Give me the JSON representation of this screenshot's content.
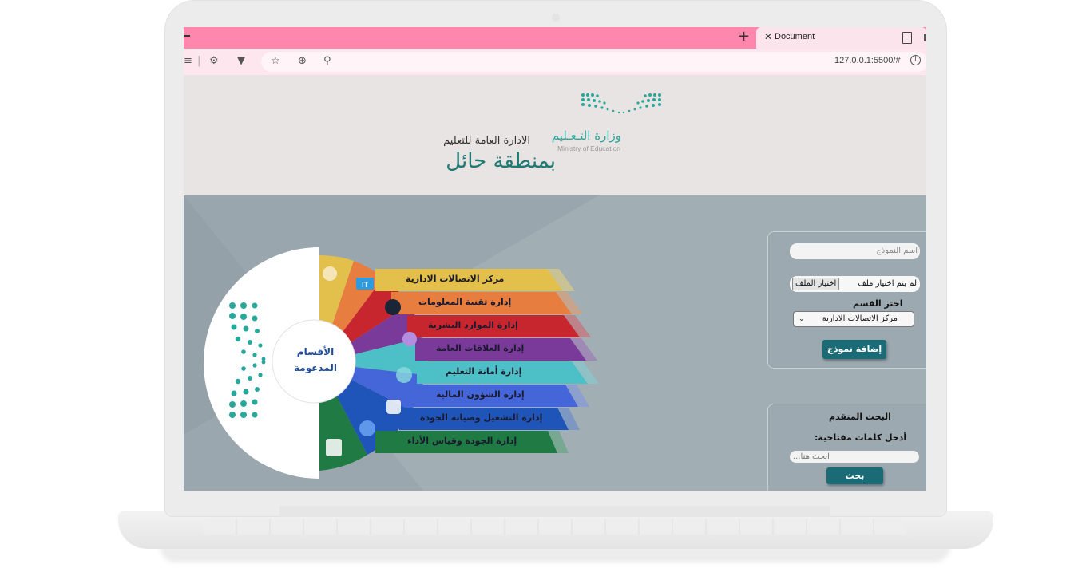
{
  "browser": {
    "tab_title": "Document",
    "url": "127.0.0.1:5500/#",
    "accent_color": "#ff87ad"
  },
  "header": {
    "ministry_arabic": "وزارة التـعـليم",
    "ministry_english": "Ministry of Education",
    "directorate_line1": "الادارة العامة للتعليم",
    "directorate_line2": "بمنطقة حائل"
  },
  "departments_wheel": {
    "center_line1": "الأقسام",
    "center_line2": "المدعومة",
    "items": [
      {
        "label": "مركز الاتصالات الادارية",
        "color": "#e3c04c"
      },
      {
        "label": "إدارة تقنية المعلومات",
        "color": "#e77d3f"
      },
      {
        "label": "إدارة الموارد البشرية",
        "color": "#c8262e"
      },
      {
        "label": "إدارة العلاقات العامة",
        "color": "#7a3a99"
      },
      {
        "label": "إدارة أمانة التعليم",
        "color": "#4cc0c6"
      },
      {
        "label": "إدارة الشؤون المالية",
        "color": "#4566d8"
      },
      {
        "label": "إدارة التشغيل وصيانة الجودة",
        "color": "#1f55b8"
      },
      {
        "label": "إدارة الجودة وقياس الأداء",
        "color": "#1f7a43"
      }
    ]
  },
  "add_form": {
    "name_placeholder": "اسم النموذج",
    "file_button": "اختيار الملف",
    "file_status": "لم يتم اختيار ملف",
    "section_label": "اختر القسم",
    "section_selected": "مركز الاتصالات الادارية",
    "submit_label": "إضافة نموذج"
  },
  "search": {
    "title": "البحث المتقدم",
    "keywords_label": "أدخل كلمات مفتاحية:",
    "placeholder": "ابحث هنا...",
    "button_label": "بحث"
  }
}
